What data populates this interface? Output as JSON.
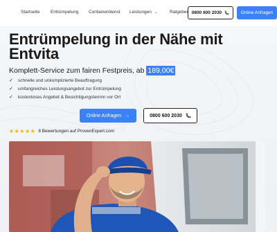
{
  "nav": {
    "items": [
      "Startseite",
      "Entrümpelung",
      "Containerdienst",
      "Leistungen",
      "Ratgeber"
    ],
    "phone": "0800 600 2030",
    "cta": "Online Anfragen"
  },
  "hero": {
    "title": "Entrümpelung in der Nähe mit Entvita",
    "subtitle": "Komplett-Service zum fairen Festpreis, ab",
    "price": "189,00€",
    "bullets": [
      "schnelle und unkomplizierte Beauftragung",
      "umfangreiches Leistungsangebot zur Entrümpelung",
      "kostenloses Angebot & Besichtigungstermin vor Ort"
    ],
    "cta_primary": "Online Anfragen",
    "cta_primary_icon": "arrow-right-icon",
    "phone": "0800 600 2030",
    "phone_icon": "phone-icon",
    "stars": "★★★★★",
    "rating_text": "8 Bewertungen auf ProvenExpert.com"
  },
  "colors": {
    "accent": "#3b82f6",
    "star": "#f5b400",
    "text": "#1a1a1a"
  }
}
